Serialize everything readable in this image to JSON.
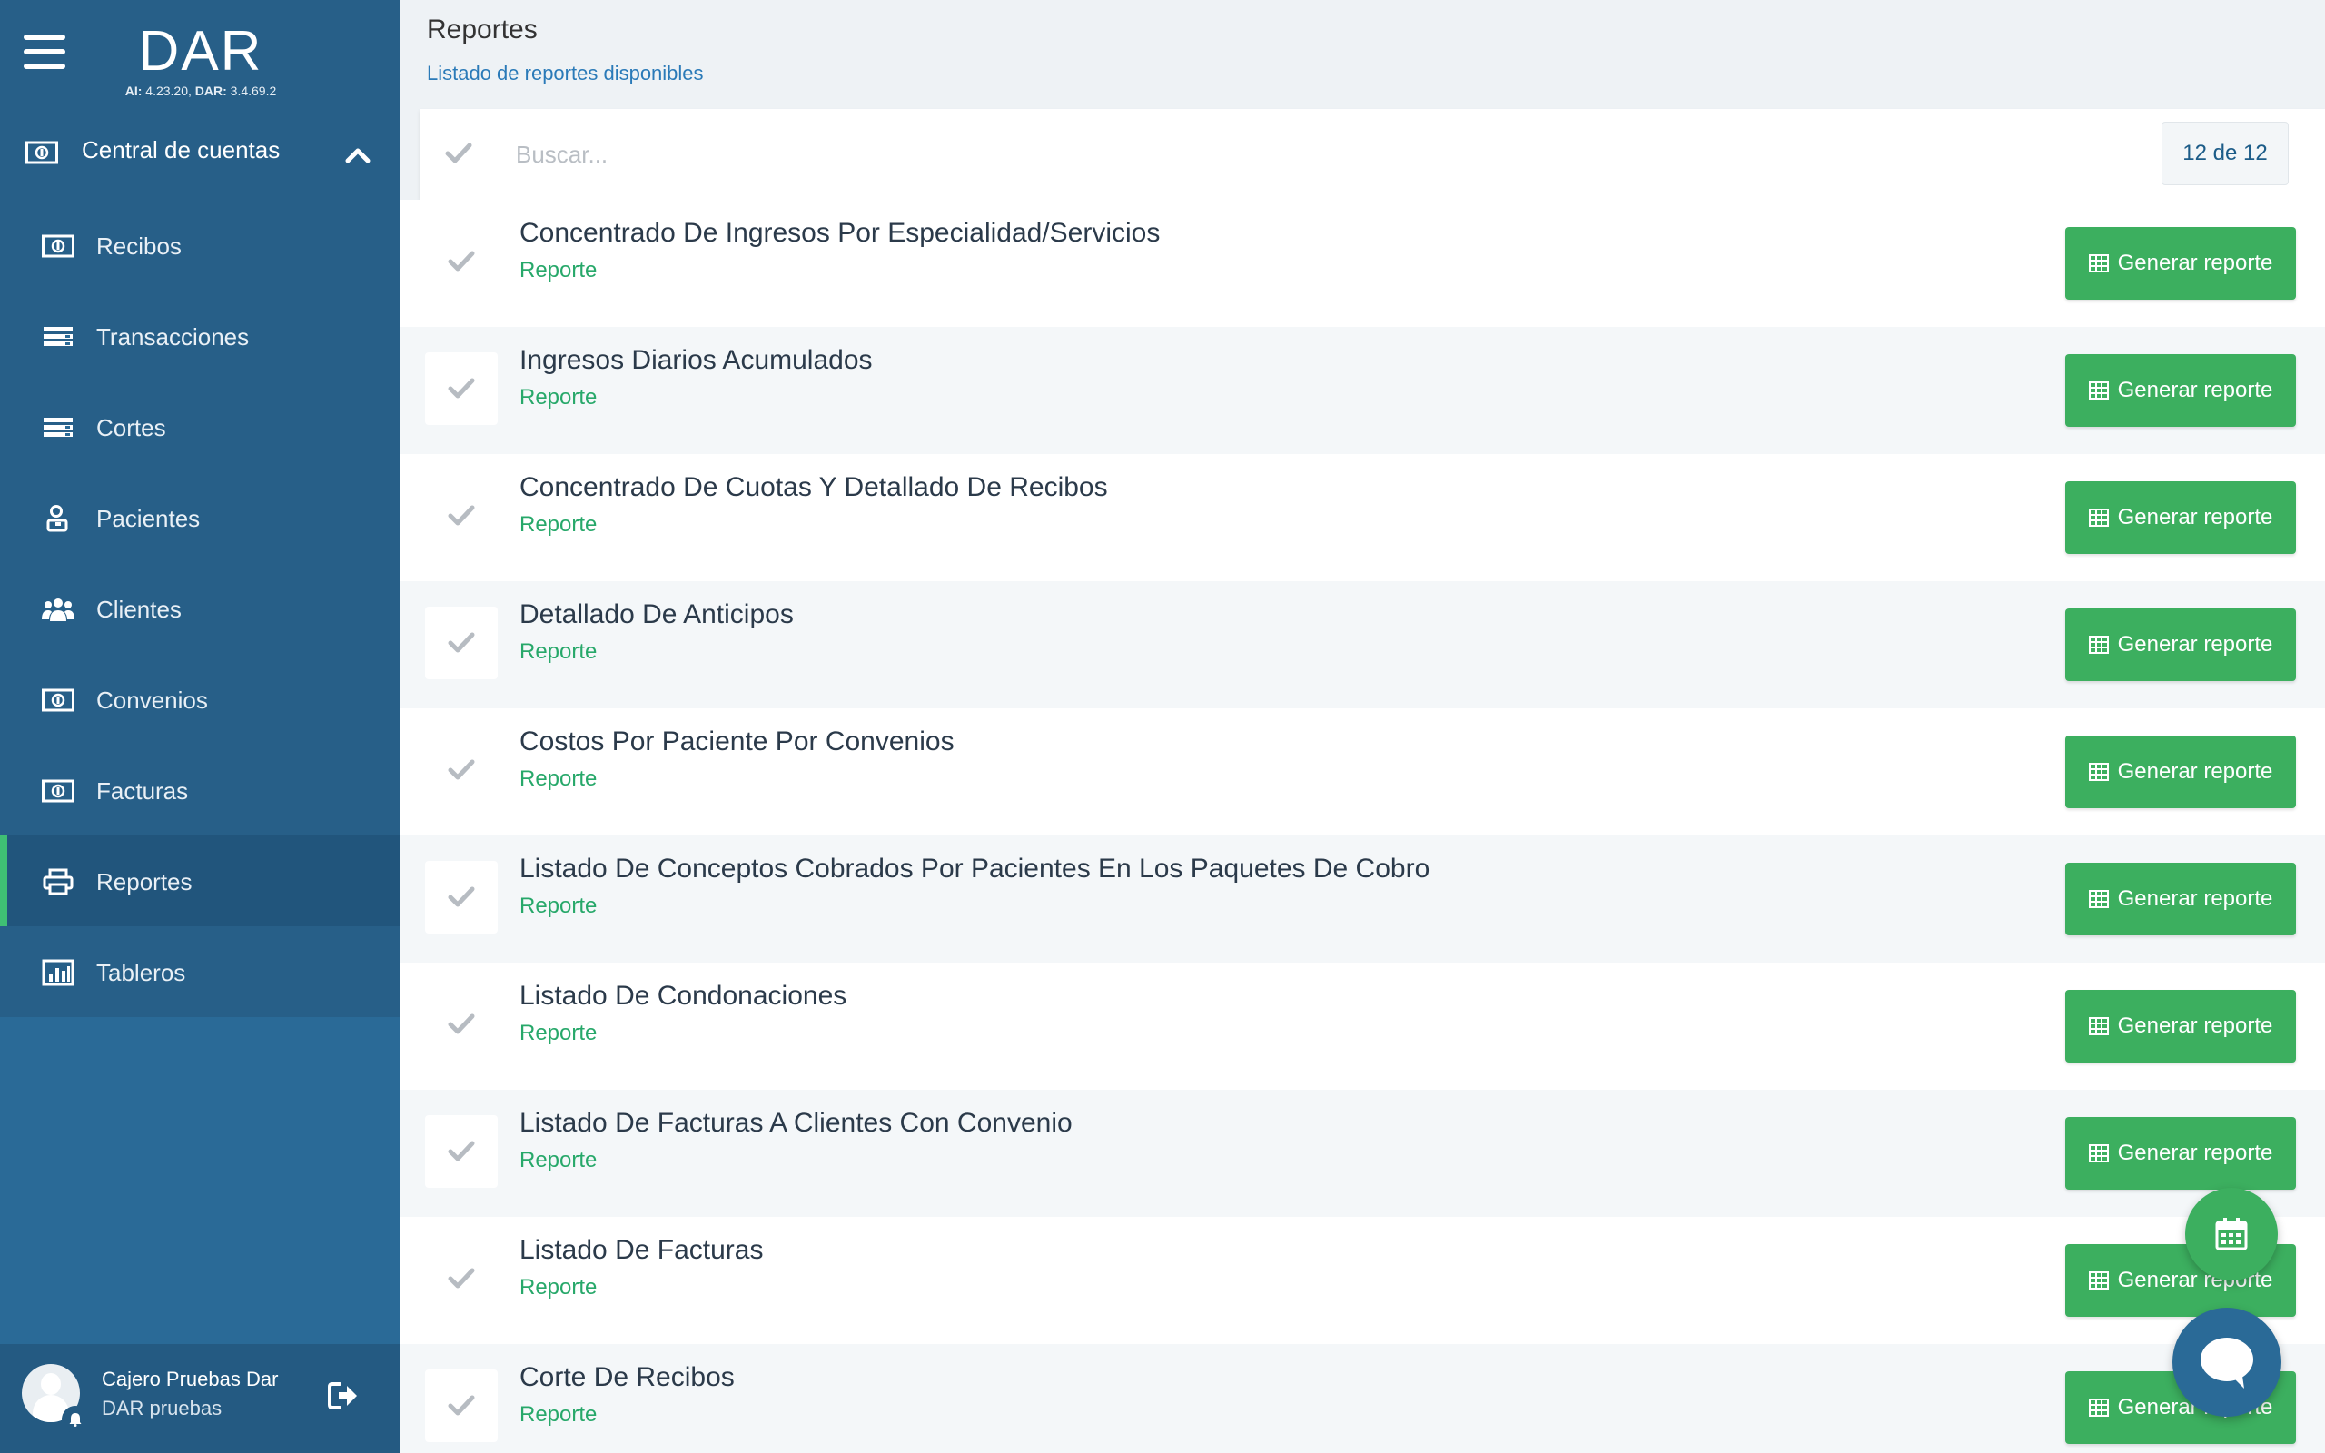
{
  "app": {
    "logo": "DAR",
    "version_ai_label": "AI:",
    "version_ai": "4.23.20,",
    "version_dar_label": "DAR:",
    "version_dar": "3.4.69.2"
  },
  "sidebar": {
    "section": {
      "label": "Central de cuentas",
      "icon": "money-icon",
      "expanded": true
    },
    "items": [
      {
        "label": "Recibos",
        "icon": "money-icon",
        "active": false
      },
      {
        "label": "Transacciones",
        "icon": "list-icon",
        "active": false
      },
      {
        "label": "Cortes",
        "icon": "list-icon",
        "active": false
      },
      {
        "label": "Pacientes",
        "icon": "patient-icon",
        "active": false
      },
      {
        "label": "Clientes",
        "icon": "users-icon",
        "active": false
      },
      {
        "label": "Convenios",
        "icon": "money-icon",
        "active": false
      },
      {
        "label": "Facturas",
        "icon": "money-icon",
        "active": false
      },
      {
        "label": "Reportes",
        "icon": "print-icon",
        "active": true
      },
      {
        "label": "Tableros",
        "icon": "bar-chart-icon",
        "active": false
      }
    ],
    "user": {
      "name": "Cajero Pruebas Dar",
      "subtitle": "DAR pruebas"
    }
  },
  "header": {
    "title": "Reportes",
    "subtitle": "Listado de reportes disponibles"
  },
  "search": {
    "placeholder": "Buscar...",
    "value": "",
    "count": "12 de 12"
  },
  "reports": [
    {
      "title": "Concentrado De Ingresos Por Especialidad/Servicios",
      "type": "Reporte",
      "button": "Generar reporte"
    },
    {
      "title": "Ingresos Diarios Acumulados",
      "type": "Reporte",
      "button": "Generar reporte"
    },
    {
      "title": "Concentrado De Cuotas Y Detallado De Recibos",
      "type": "Reporte",
      "button": "Generar reporte"
    },
    {
      "title": "Detallado De Anticipos",
      "type": "Reporte",
      "button": "Generar reporte"
    },
    {
      "title": "Costos Por Paciente Por Convenios",
      "type": "Reporte",
      "button": "Generar reporte"
    },
    {
      "title": "Listado De Conceptos Cobrados Por Pacientes En Los Paquetes De Cobro",
      "type": "Reporte",
      "button": "Generar reporte"
    },
    {
      "title": "Listado De Condonaciones",
      "type": "Reporte",
      "button": "Generar reporte"
    },
    {
      "title": "Listado De Facturas A Clientes Con Convenio",
      "type": "Reporte",
      "button": "Generar reporte"
    },
    {
      "title": "Listado De Facturas",
      "type": "Reporte",
      "button": "Generar reporte"
    },
    {
      "title": "Corte De Recibos",
      "type": "Reporte",
      "button": "Generar reporte"
    }
  ],
  "colors": {
    "sidebar": "#2a6a97",
    "accent_green": "#3caf5f",
    "link_blue": "#2a7ab8"
  }
}
